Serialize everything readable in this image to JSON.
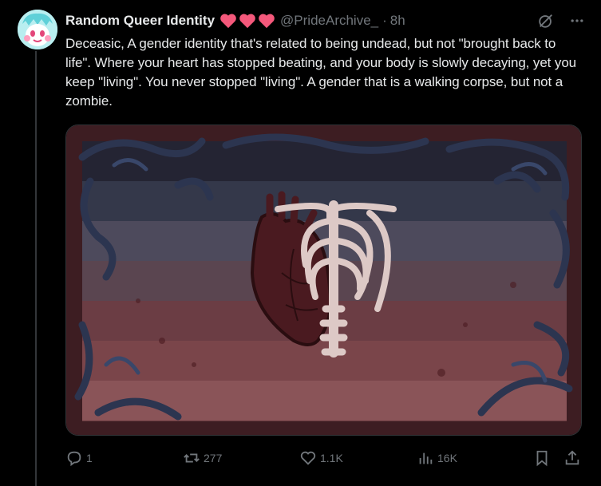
{
  "tweet": {
    "display_name": "Random Queer Identity",
    "handle": "@PrideArchive_",
    "dot": "·",
    "time": "8h",
    "text": "Deceasic, A gender identity that's related to being undead, but not \"brought back to life\". Where your heart has stopped beating, and your body is slowly decaying, yet you keep \"living\". You never stopped \"living\". A gender that is a walking corpse, but not a zombie.",
    "name_emojis": [
      "heart",
      "heart",
      "heart"
    ]
  },
  "actions": {
    "reply_count": "1",
    "retweet_count": "277",
    "like_count": "1.1K",
    "views_count": "16K"
  },
  "media": {
    "stripes": [
      "#242433",
      "#34384a",
      "#4d4a5c",
      "#5a4550",
      "#6b3d44",
      "#7a454a",
      "#8a5458"
    ],
    "frame_color": "#3d1d22",
    "ornament_color": "#2c3550",
    "bone_color": "#ddc9c6",
    "heart_color": "#4a1a20"
  },
  "colors": {
    "background": "#000000",
    "text_primary": "#e7e9ea",
    "text_secondary": "#71767b",
    "heart_emoji": "#f4587b"
  },
  "icons": {
    "reply": "reply-icon",
    "retweet": "retweet-icon",
    "like": "like-icon",
    "views": "views-icon",
    "bookmark": "bookmark-icon",
    "share": "share-icon",
    "grok": "grok-icon",
    "more": "more-icon"
  }
}
